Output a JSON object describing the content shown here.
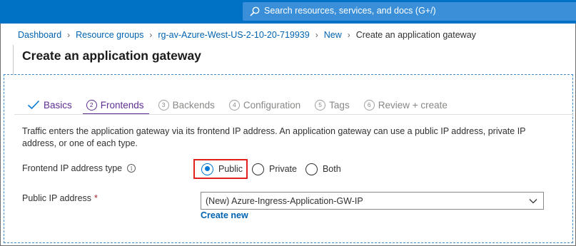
{
  "header": {
    "search_placeholder": "Search resources, services, and docs (G+/)"
  },
  "breadcrumb": {
    "items": [
      "Dashboard",
      "Resource groups",
      "rg-av-Azure-West-US-2-10-20-719939",
      "New"
    ],
    "current": "Create an application gateway"
  },
  "page": {
    "title": "Create an application gateway"
  },
  "tabs": [
    {
      "label": "Basics",
      "state": "completed",
      "icon": "checkmark-icon"
    },
    {
      "label": "Frontends",
      "state": "active",
      "step": "2"
    },
    {
      "label": "Backends",
      "state": "pending",
      "step": "3"
    },
    {
      "label": "Configuration",
      "state": "pending",
      "step": "4"
    },
    {
      "label": "Tags",
      "state": "pending",
      "step": "5"
    },
    {
      "label": "Review + create",
      "state": "pending",
      "step": "6"
    }
  ],
  "form": {
    "description": "Traffic enters the application gateway via its frontend IP address. An application gateway can use a public IP address, private IP address, or one of each type.",
    "ip_type": {
      "label": "Frontend IP address type",
      "info_icon": "info-icon",
      "options": [
        "Public",
        "Private",
        "Both"
      ],
      "selected": "Public"
    },
    "public_ip": {
      "label": "Public IP address",
      "required_marker": "*",
      "value": "(New) Azure-Ingress-Application-GW-IP",
      "create_link": "Create new"
    }
  },
  "colors": {
    "topbar": "#0072c6",
    "link": "#0063b1",
    "tab_active": "#5c2d91",
    "radio_selected": "#0078d4",
    "highlight_box": "#e0201b",
    "required": "#a4262c"
  }
}
